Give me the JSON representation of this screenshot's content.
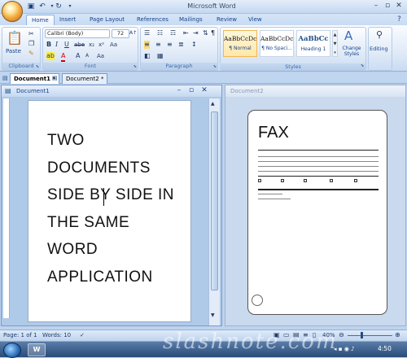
{
  "app": {
    "title": "Microsoft Word"
  },
  "tabs": [
    "Home",
    "Insert",
    "Page Layout",
    "References",
    "Mailings",
    "Review",
    "View"
  ],
  "clipboard": {
    "paste_label": "Paste",
    "group_label": "Clipboard"
  },
  "font": {
    "name": "Calibri (Body)",
    "size": "72",
    "group_label": "Font"
  },
  "paragraph": {
    "group_label": "Paragraph"
  },
  "styles": {
    "items": [
      {
        "sample": "AaBbCcDc",
        "name": "¶ Normal"
      },
      {
        "sample": "AaBbCcDc",
        "name": "¶ No Spaci..."
      },
      {
        "sample": "AaBbCc",
        "name": "Heading 1"
      }
    ],
    "change_label": "Change Styles",
    "group_label": "Styles"
  },
  "editing": {
    "label": "Editing"
  },
  "doc_tabs": [
    "Document1 *",
    "Document2 *"
  ],
  "window1": {
    "title": "Document1",
    "lines": [
      "TWO",
      "DOCUMENTS",
      "SIDE BY SIDE IN",
      "THE SAME",
      "WORD",
      "APPLICATION"
    ]
  },
  "window2": {
    "title": "Document2",
    "fax": "FAX"
  },
  "status": {
    "page": "Page: 1 of 1",
    "words": "Words: 10",
    "zoom": "40%"
  },
  "taskbar": {
    "time": "4:50"
  },
  "watermark": "slashnote.com"
}
